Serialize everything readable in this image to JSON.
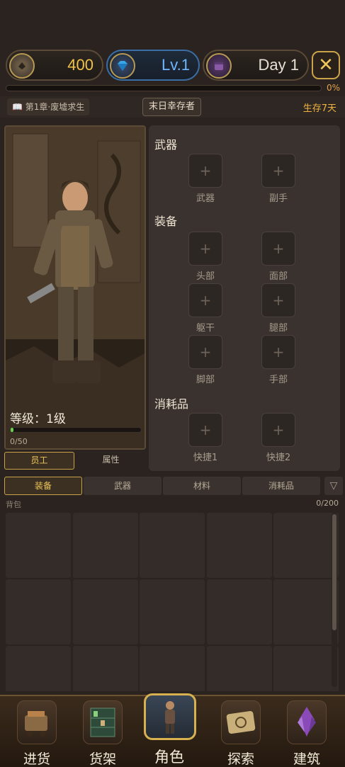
{
  "resources": {
    "coins": "400",
    "level": "Lv.1",
    "day": "Day 1",
    "close_symbol": "✕"
  },
  "progress": {
    "fraction": 0.0,
    "percent_label": "0%"
  },
  "info": {
    "chapter_icon": "📖",
    "chapter": "第1章·废墟求生",
    "title_badge": "末日幸存者",
    "survive_days": "生存7天"
  },
  "character": {
    "level_label": "等级：1级",
    "xp_label": "0/50",
    "xp_fraction": 0.02,
    "tabs": [
      {
        "label": "员工",
        "active": true
      },
      {
        "label": "属性",
        "active": false
      }
    ]
  },
  "equipment": {
    "plus": "+",
    "sections": [
      {
        "title": "武器",
        "slots": [
          "武器",
          "副手"
        ]
      },
      {
        "title": "装备",
        "slots": [
          "头部",
          "面部",
          "躯干",
          "腿部",
          "脚部",
          "手部"
        ]
      },
      {
        "title": "消耗品",
        "slots": [
          "快捷1",
          "快捷2"
        ]
      }
    ]
  },
  "inventory": {
    "tabs": [
      {
        "label": "装备",
        "active": true
      },
      {
        "label": "武器",
        "active": false
      },
      {
        "label": "材料",
        "active": false
      },
      {
        "label": "消耗品",
        "active": false
      }
    ],
    "filter_symbol": "▽",
    "bag_label": "背包",
    "count": "0/200"
  },
  "nav": [
    {
      "label": "进货",
      "icon": "cart-icon",
      "active": false
    },
    {
      "label": "货架",
      "icon": "shelf-icon",
      "active": false
    },
    {
      "label": "角色",
      "icon": "character-icon",
      "active": true
    },
    {
      "label": "探索",
      "icon": "map-icon",
      "active": false
    },
    {
      "label": "建筑",
      "icon": "crystal-icon",
      "active": false
    }
  ],
  "colors": {
    "accent_gold": "#c9a24a",
    "coin_text": "#f2c14a",
    "level_text": "#6fb6ff",
    "xp_fill": "#6ad24a",
    "progress_fill": "#e3a24a"
  }
}
